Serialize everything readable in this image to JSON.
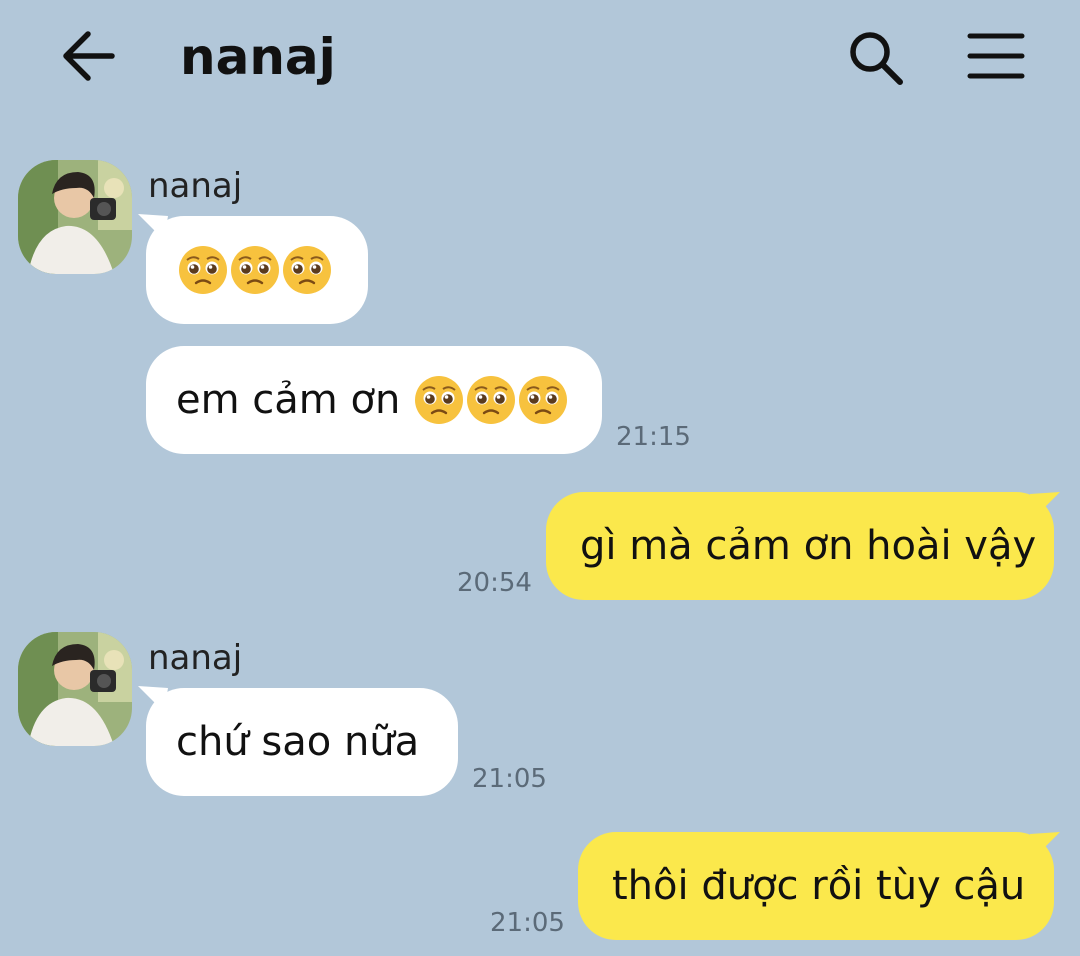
{
  "header": {
    "title": "nanaj",
    "back_icon": "arrow-left-icon",
    "search_icon": "search-icon",
    "menu_icon": "hamburger-menu-icon"
  },
  "colors": {
    "background": "#b2c7d9",
    "incoming_bubble": "#ffffff",
    "outgoing_bubble": "#fbe84c"
  },
  "messages": [
    {
      "direction": "incoming",
      "sender": "nanaj",
      "text": "",
      "emoji": [
        "🥺",
        "🥺",
        "🥺"
      ]
    },
    {
      "direction": "incoming",
      "text": "em cảm ơn",
      "emoji": [
        "🥺",
        "🥺",
        "🥺"
      ],
      "time": "21:15"
    },
    {
      "direction": "outgoing",
      "text": "gì mà cảm ơn hoài vậy",
      "time": "20:54"
    },
    {
      "direction": "incoming",
      "sender": "nanaj",
      "text": "chứ sao nữa",
      "time": "21:05"
    },
    {
      "direction": "outgoing",
      "text": "thôi được rồi tùy cậu",
      "time": "21:05"
    }
  ]
}
